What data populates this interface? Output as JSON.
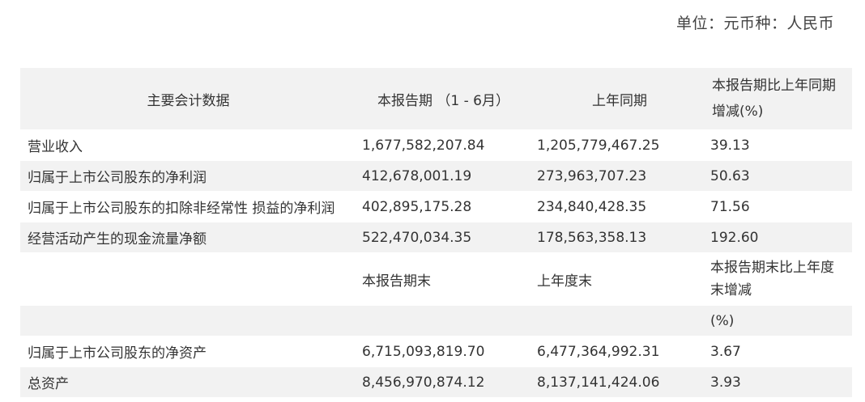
{
  "unit_note": "单位：元币种：人民币",
  "header": {
    "col0": "主要会计数据",
    "col1": "本报告期 （1 - 6月）",
    "col2": "上年同期",
    "col3_line1": "本报告期比上年同期",
    "col3_line2": "增减(%)"
  },
  "rows": [
    {
      "label": "营业收入",
      "current": "1,677,582,207.84",
      "prior": "1,205,779,467.25",
      "change": "39.13"
    },
    {
      "label": "归属于上市公司股东的净利润",
      "current": "412,678,001.19",
      "prior": "273,963,707.23",
      "change": "50.63"
    },
    {
      "label": "归属于上市公司股东的扣除非经常性 损益的净利润",
      "current": "402,895,175.28",
      "prior": "234,840,428.35",
      "change": "71.56"
    },
    {
      "label": "经营活动产生的现金流量净额",
      "current": "522,470,034.35",
      "prior": "178,563,358.13",
      "change": "192.60"
    }
  ],
  "subheader": {
    "col1": "本报告期末",
    "col2": "上年度末",
    "col3_line1": "本报告期末比上年度",
    "col3_line2": "末增减",
    "col3_line3": "(%)"
  },
  "rows2": [
    {
      "label": "归属于上市公司股东的净资产",
      "current": "6,715,093,819.70",
      "prior": "6,477,364,992.31",
      "change": "3.67"
    },
    {
      "label": "总资产",
      "current": "8,456,970,874.12",
      "prior": "8,137,141,424.06",
      "change": "3.93"
    }
  ]
}
